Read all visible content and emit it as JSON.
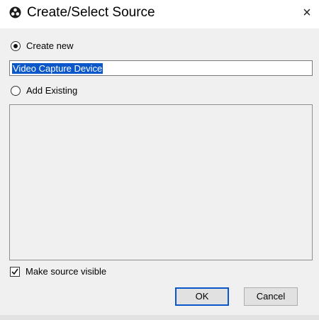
{
  "window": {
    "title": "Create/Select Source",
    "close_glyph": "×",
    "icon": "obs-app-icon",
    "close_icon": "close-icon"
  },
  "create_new": {
    "label": "Create new",
    "selected": true,
    "name_value": "Video Capture Device"
  },
  "add_existing": {
    "label": "Add Existing",
    "selected": false,
    "items": []
  },
  "make_visible": {
    "label": "Make source visible",
    "checked": true
  },
  "buttons": {
    "ok_label": "OK",
    "cancel_label": "Cancel"
  },
  "colors": {
    "selection": "#0a57c9",
    "dialog_bg": "#f0f0f0",
    "default_button_border": "#0a57c9"
  }
}
